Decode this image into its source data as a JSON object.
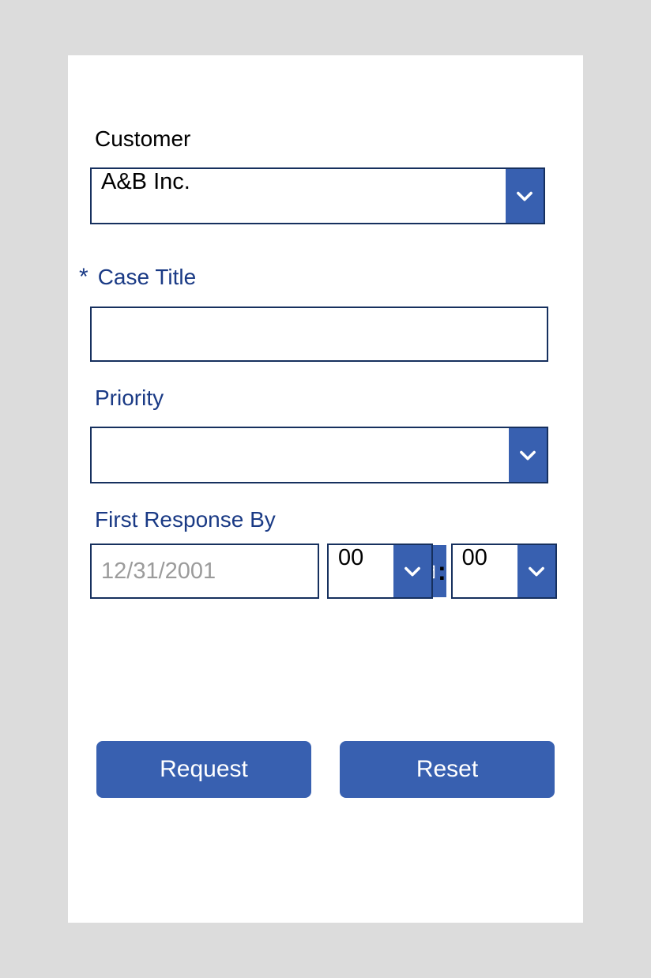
{
  "form": {
    "customer": {
      "label": "Customer",
      "value": "A&B Inc."
    },
    "case_title": {
      "required_marker": "*",
      "label": "Case Title",
      "value": ""
    },
    "priority": {
      "label": "Priority",
      "value": ""
    },
    "first_response": {
      "label": "First Response By",
      "date_placeholder": "12/31/2001",
      "hour": "00",
      "separator": ":",
      "minute": "00"
    }
  },
  "actions": {
    "request": "Request",
    "reset": "Reset"
  }
}
